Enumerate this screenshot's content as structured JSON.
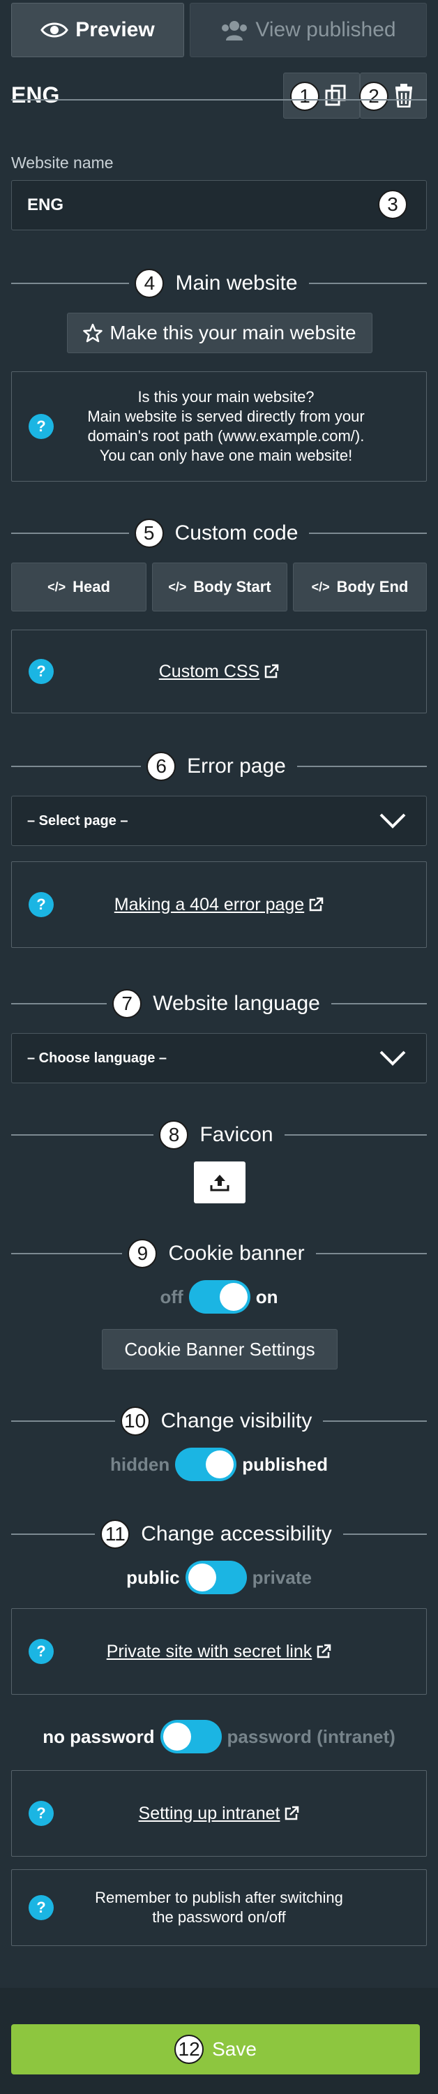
{
  "tabs": {
    "preview": "Preview",
    "view_published": "View published"
  },
  "page": {
    "title": "ENG"
  },
  "website_name": {
    "label": "Website name",
    "value": "ENG"
  },
  "main_website": {
    "title": "Main website",
    "button": "Make this your main website",
    "info_line1": "Is this your main website?",
    "info_line2": "Main website is served directly from your",
    "info_line3": "domain's root path (www.example.com/).",
    "info_line4": "You can only have one main website!"
  },
  "custom_code": {
    "title": "Custom code",
    "head": "Head",
    "body_start": "Body Start",
    "body_end": "Body End",
    "link": "Custom CSS"
  },
  "error_page": {
    "title": "Error page",
    "select_value": "– Select page –",
    "link": "Making a 404 error page"
  },
  "website_language": {
    "title": "Website language",
    "select_value": "– Choose language –"
  },
  "favicon": {
    "title": "Favicon"
  },
  "cookie_banner": {
    "title": "Cookie banner",
    "off": "off",
    "on": "on",
    "settings_button": "Cookie Banner Settings"
  },
  "visibility": {
    "title": "Change visibility",
    "hidden": "hidden",
    "published": "published"
  },
  "accessibility": {
    "title": "Change accessibility",
    "public": "public",
    "private": "private",
    "link": "Private site with secret link",
    "no_password": "no password",
    "password": "password (intranet)",
    "intranet_link": "Setting up intranet",
    "reminder_line1": "Remember to publish after switching",
    "reminder_line2": "the password on/off"
  },
  "save": {
    "label": "Save"
  },
  "badges": [
    "1",
    "2",
    "3",
    "4",
    "5",
    "6",
    "7",
    "8",
    "9",
    "10",
    "11",
    "12"
  ],
  "colors": {
    "background": "#243038",
    "accent": "#1bb5e3",
    "save": "#8dc63f"
  }
}
